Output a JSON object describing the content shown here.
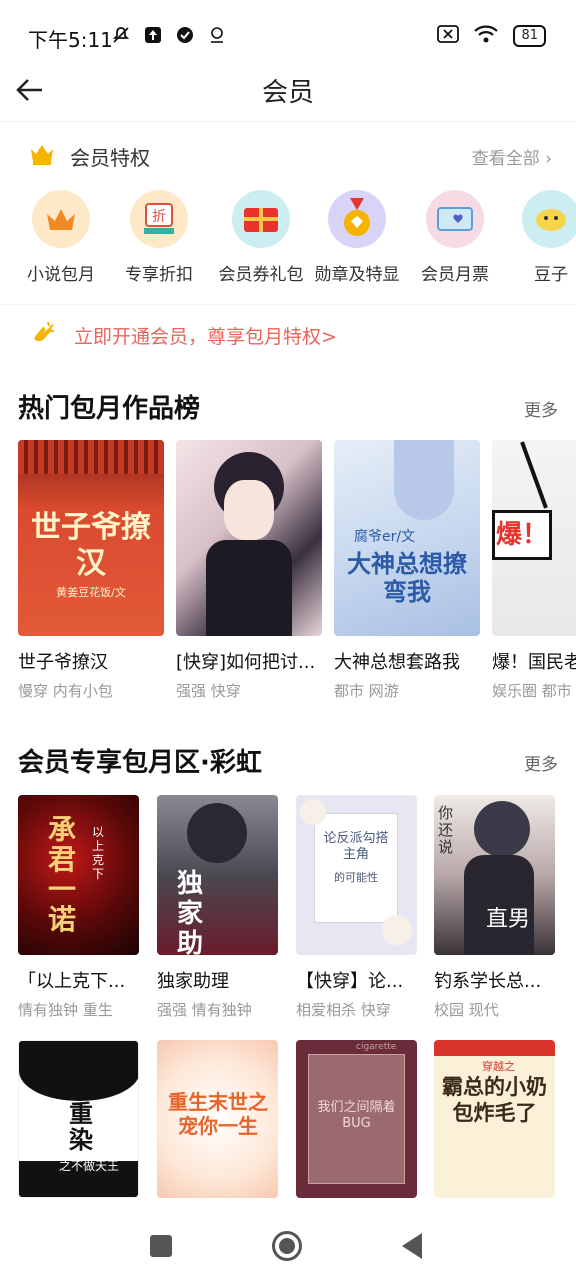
{
  "status": {
    "time": "下午5:11",
    "battery": "81"
  },
  "header": {
    "title": "会员"
  },
  "privileges": {
    "title": "会员特权",
    "view_all": "查看全部",
    "items": [
      {
        "label": "小说包月",
        "icon": "crown-icon"
      },
      {
        "label": "专享折扣",
        "icon": "discount-icon"
      },
      {
        "label": "会员券礼包",
        "icon": "gift-icon"
      },
      {
        "label": "勋章及特显",
        "icon": "medal-icon"
      },
      {
        "label": "会员月票",
        "icon": "ticket-icon"
      },
      {
        "label": "豆子",
        "icon": "beans-icon"
      }
    ]
  },
  "promo": {
    "text": "立即开通会员，尊享包月特权>"
  },
  "hot_section": {
    "title": "热门包月作品榜",
    "more": "更多",
    "books": [
      {
        "title": "世子爷撩汉",
        "tags": "慢穿 内有小包",
        "cover_text": "世子爷撩汉",
        "cover_author": "黄姜豆花饭/文"
      },
      {
        "title": "[快穿]如何把讨...",
        "tags": "强强 快穿",
        "cover_text": "",
        "cover_author": ""
      },
      {
        "title": "大神总想套路我",
        "tags": "都市 网游",
        "cover_text": "大神总想撩弯我",
        "cover_author": "腐爷er/文"
      },
      {
        "title": "爆！国民老",
        "tags": "娱乐圈 都市",
        "cover_text": "爆！",
        "cover_author": ""
      }
    ]
  },
  "rainbow_section": {
    "title": "会员专享包月区·彩虹",
    "more": "更多",
    "books": [
      {
        "title": "「以上克下...",
        "tags": "情有独钟 重生",
        "cover_text": "承君一诺",
        "cover_sub": "以上克下"
      },
      {
        "title": "独家助理",
        "tags": "强强 情有独钟",
        "cover_text": "独家助理",
        "cover_sub": ""
      },
      {
        "title": "【快穿】论...",
        "tags": "相爱相杀 快穿",
        "cover_text": "论反派勾搭主角",
        "cover_sub": "的可能性"
      },
      {
        "title": "钓系学长总...",
        "tags": "校园 现代",
        "cover_text": "直男",
        "cover_sub": "你还说"
      }
    ],
    "row2": [
      {
        "cover_text": "重染",
        "cover_sub": "之不做天王"
      },
      {
        "cover_text": "重生末世之宠你一生",
        "cover_sub": ""
      },
      {
        "cover_text": "我们之间隔着BUG",
        "cover_sub": "cigarette"
      },
      {
        "cover_text": "霸总的小奶包炸毛了",
        "cover_sub": "穿越之"
      }
    ]
  }
}
